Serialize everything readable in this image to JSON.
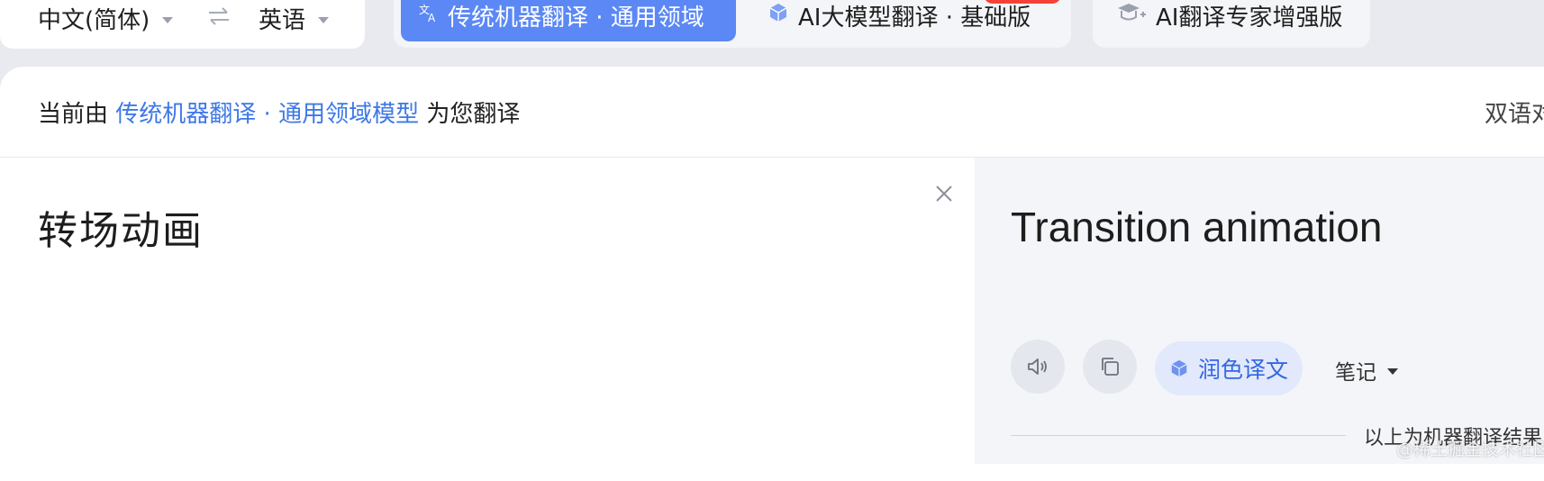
{
  "languages": {
    "source": "中文(简体)",
    "target": "英语",
    "swap_icon": "swap-arrows-icon"
  },
  "modes": [
    {
      "label": "传统机器翻译 · 通用领域",
      "icon": "translate-icon",
      "active": true
    },
    {
      "label": "AI大模型翻译 · 基础版",
      "icon": "cube-icon",
      "active": false
    },
    {
      "label": "AI翻译专家增强版",
      "icon": "expert-icon",
      "active": false
    }
  ],
  "info": {
    "prefix": "当前由",
    "model": "传统机器翻译 · 通用领域模型",
    "suffix": "为您翻译",
    "bilingual": "双语对"
  },
  "source": {
    "text": "转场动画"
  },
  "target": {
    "text": "Transition animation"
  },
  "actions": {
    "polish_label": "润色译文",
    "notes_label": "笔记"
  },
  "footer": {
    "machine_note": "以上为机器翻译结果",
    "watermark": "@稀土掘金技术社区"
  },
  "colors": {
    "accent": "#5b88f5",
    "link": "#3e78e7",
    "badge": "#f44336"
  }
}
